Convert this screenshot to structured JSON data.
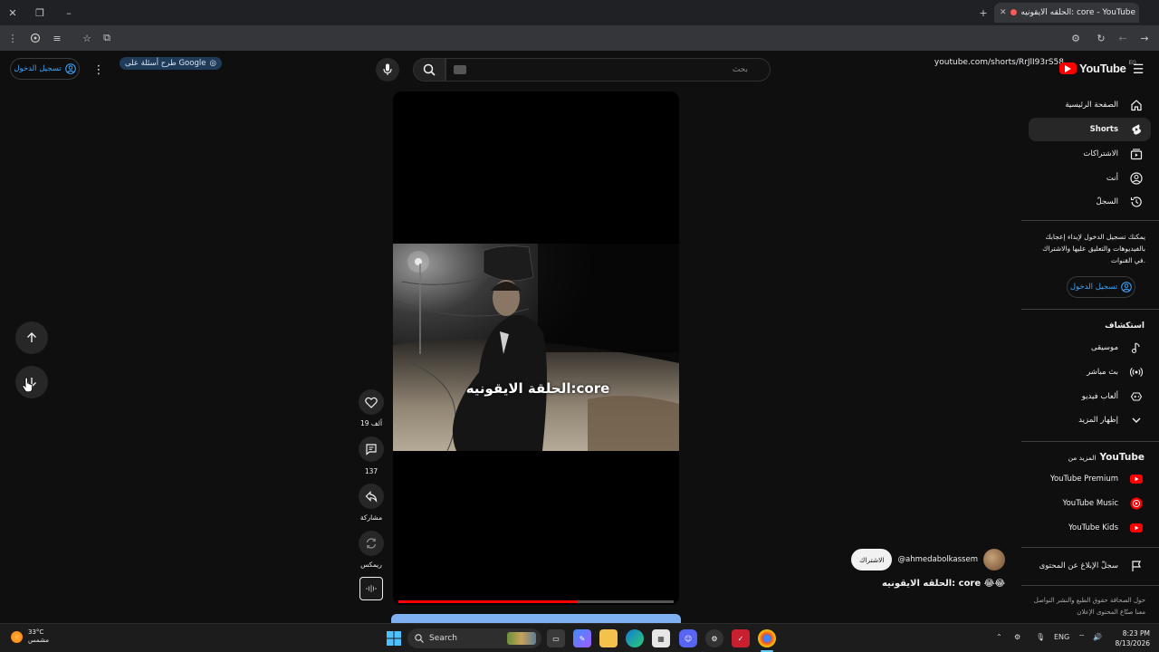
{
  "browser": {
    "tab_title": "الحلقه الايقونيه: core - YouTube",
    "url": "youtube.com/shorts/RrJlI93rS58",
    "ask_chip": "طرح أسئلة على Google"
  },
  "header": {
    "logo_text": "YouTube",
    "country_code": "EG",
    "search_placeholder": "بحث",
    "sign_in_label": "تسجيل الدخول"
  },
  "sidebar": {
    "items": [
      {
        "label": "الصفحة الرئيسية",
        "icon": "home-icon"
      },
      {
        "label": "Shorts",
        "icon": "shorts-icon",
        "active": true
      },
      {
        "label": "الاشتراكات",
        "icon": "subscriptions-icon"
      },
      {
        "label": "أنت",
        "icon": "you-icon"
      },
      {
        "label": "السجلّ",
        "icon": "history-icon"
      }
    ],
    "signin_note": "يمكنك تسجيل الدخول لإبداء إعجابك بالفيديوهات والتعليق عليها والاشتراك في القنوات.",
    "signin_button": "تسجيل الدخول",
    "explore_heading": "استكشاف",
    "explore": [
      {
        "label": "موسيقى",
        "icon": "music-icon"
      },
      {
        "label": "بث مباشر",
        "icon": "live-icon"
      },
      {
        "label": "ألعاب فيديو",
        "icon": "gaming-icon"
      },
      {
        "label": "إظهار المزيد",
        "icon": "chevron-down-icon"
      }
    ],
    "more_heading_prefix": "المزيد من",
    "more_heading_brand": "YouTube",
    "more": [
      {
        "label": "YouTube Premium"
      },
      {
        "label": "YouTube Music"
      },
      {
        "label": "YouTube Kids"
      }
    ],
    "report_label": "سجلّ الإبلاغ عن المحتوى",
    "footer": "حول  الصحافة  حقوق الطبع والنشر  التواصل معنا  صنّاع المحتوى  الإعلان"
  },
  "short": {
    "caption": "الحلقة الايقونيه:core",
    "progress": 0.65,
    "likes": "19 ألف",
    "comments": "137",
    "share_label": "مشاركة",
    "remix_label": "ريمكس",
    "channel": "@ahmedabolkassem",
    "subscribe_label": "الاشتراك",
    "title": "الحلقه الايقونيه: core 😂😂"
  },
  "taskbar": {
    "weather_temp": "33°C",
    "weather_desc": "مشمس",
    "search_label": "Search",
    "language": "ENG",
    "time": "8:23 PM",
    "date": "8/13/2026"
  },
  "colors": {
    "background": "#0f0f0f",
    "brand_red": "#ff0000",
    "link_blue": "#3ea6ff",
    "active_item": "#272727"
  }
}
